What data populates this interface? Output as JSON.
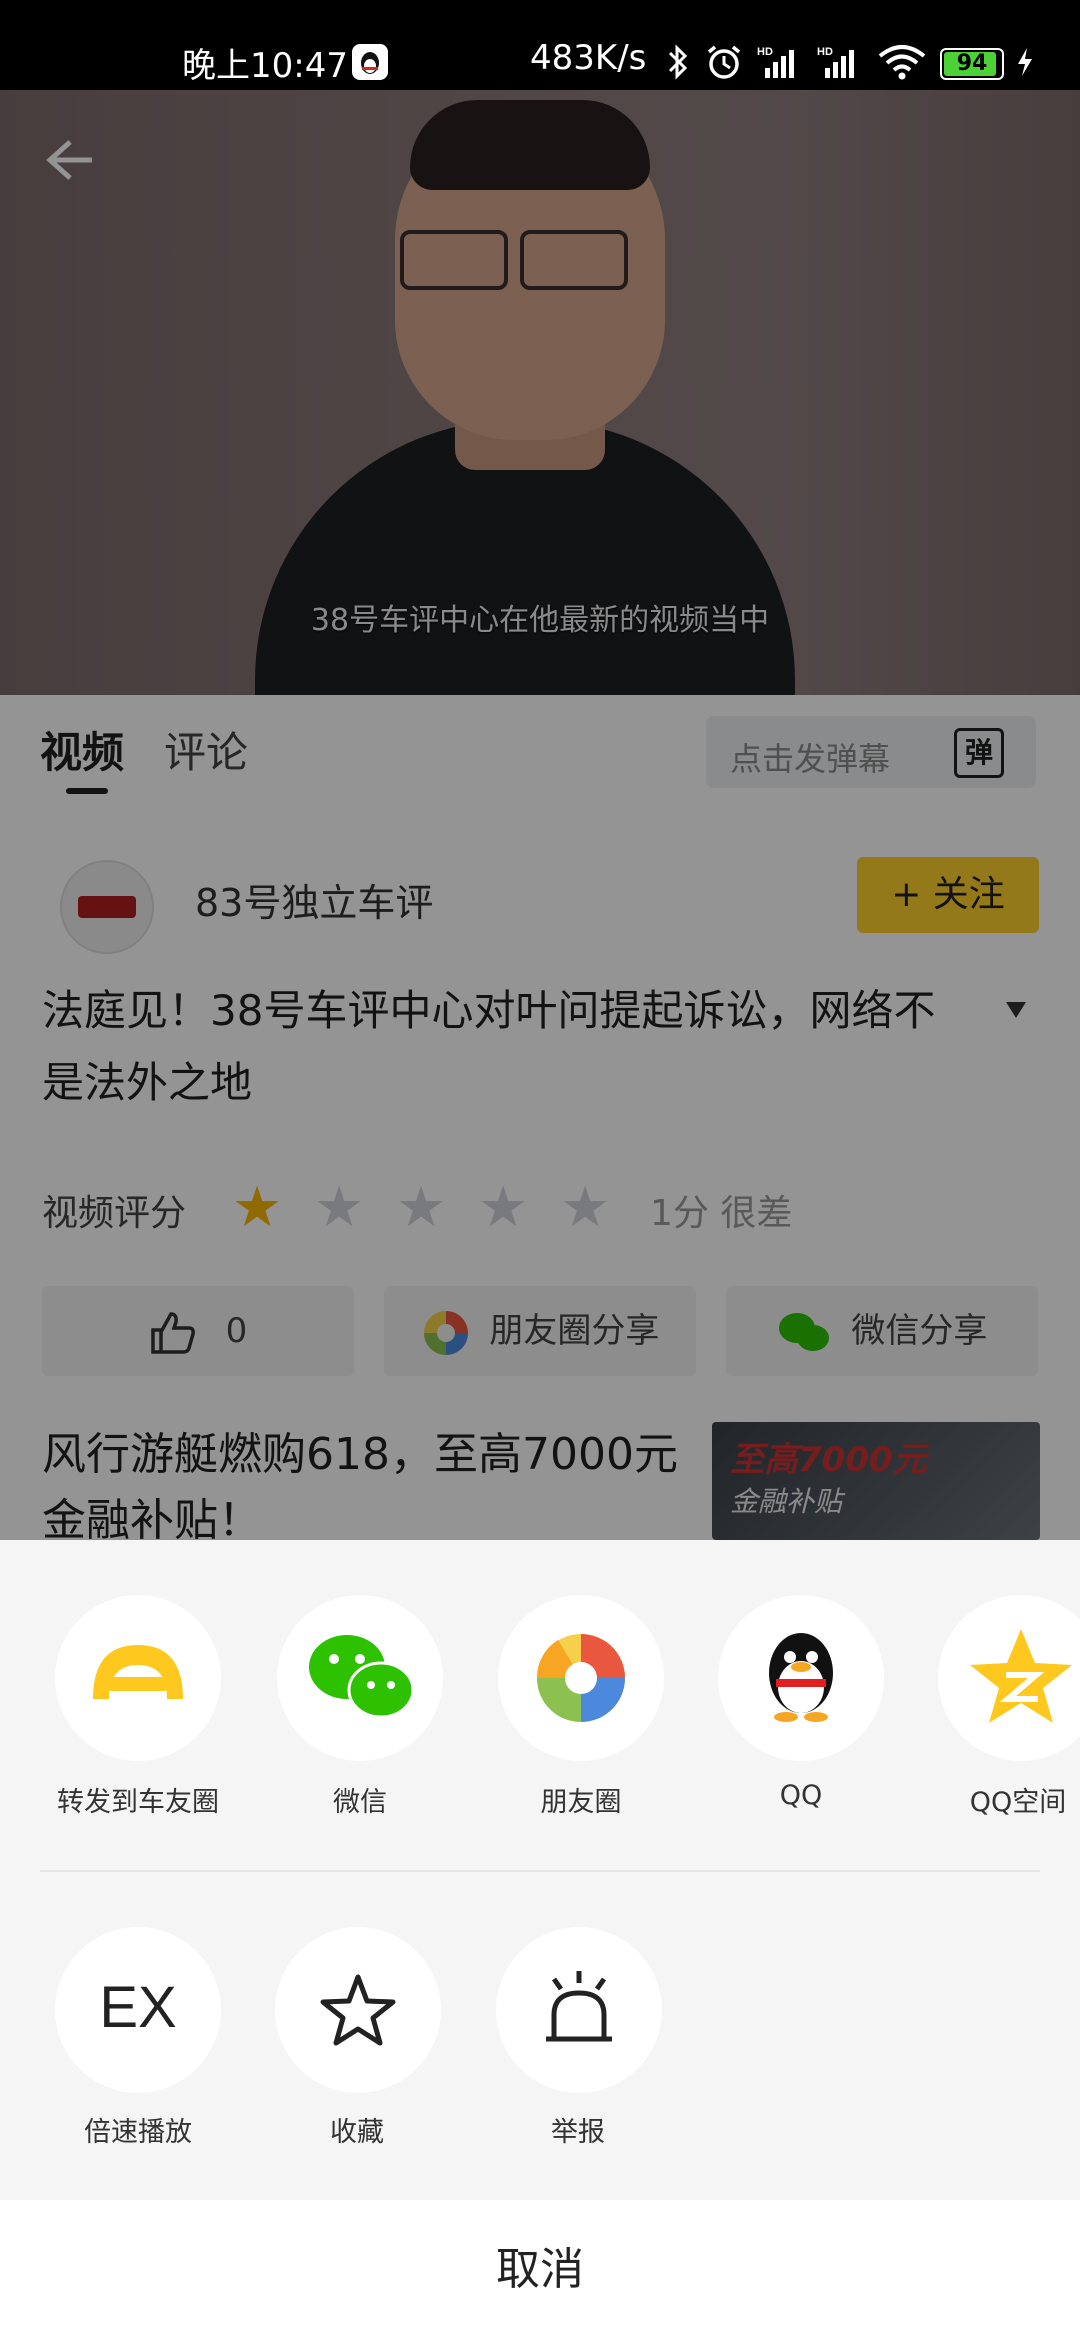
{
  "status_bar": {
    "time": "晚上10:47",
    "net_speed": "483K/s",
    "battery": "94",
    "icons": [
      "qq-notification-icon",
      "bluetooth-icon",
      "alarm-icon",
      "signal-hd-icon",
      "signal-hd-icon",
      "wifi-icon",
      "battery-icon",
      "charging-icon"
    ]
  },
  "video": {
    "subtitle": "38号车评中心在他最新的视频当中"
  },
  "tabs": {
    "video": "视频",
    "comment": "评论"
  },
  "danmu": {
    "placeholder": "点击发弹幕",
    "icon_text": "弹"
  },
  "author": {
    "name": "83号独立车评",
    "follow_label": "+ 关注"
  },
  "title": "法庭见！38号车评中心对叶问提起诉讼，网络不是法外之地",
  "rating": {
    "label": "视频评分",
    "stars_filled": 1,
    "stars_total": 5,
    "text": "1分 很差"
  },
  "actions": {
    "likes": "0",
    "moments_share": "朋友圈分享",
    "wechat_share": "微信分享"
  },
  "ad": {
    "title": "风行游艇燃购618，至高7000元金融补贴！",
    "image_text_1": "至高7000元",
    "image_text_2": "金融补贴"
  },
  "share_row_1": [
    {
      "label": "转发到车友圈",
      "icon": "car-circle-icon"
    },
    {
      "label": "微信",
      "icon": "wechat-icon"
    },
    {
      "label": "朋友圈",
      "icon": "moments-icon"
    },
    {
      "label": "QQ",
      "icon": "qq-icon"
    },
    {
      "label": "QQ空间",
      "icon": "qzone-icon"
    }
  ],
  "share_row_2": [
    {
      "label": "倍速播放",
      "icon": "speed-icon",
      "icon_text": "EX"
    },
    {
      "label": "收藏",
      "icon": "star-icon"
    },
    {
      "label": "举报",
      "icon": "alarm-report-icon"
    }
  ],
  "cancel": "取消",
  "colors": {
    "accent": "#ffd030",
    "star": "#f5b700"
  }
}
